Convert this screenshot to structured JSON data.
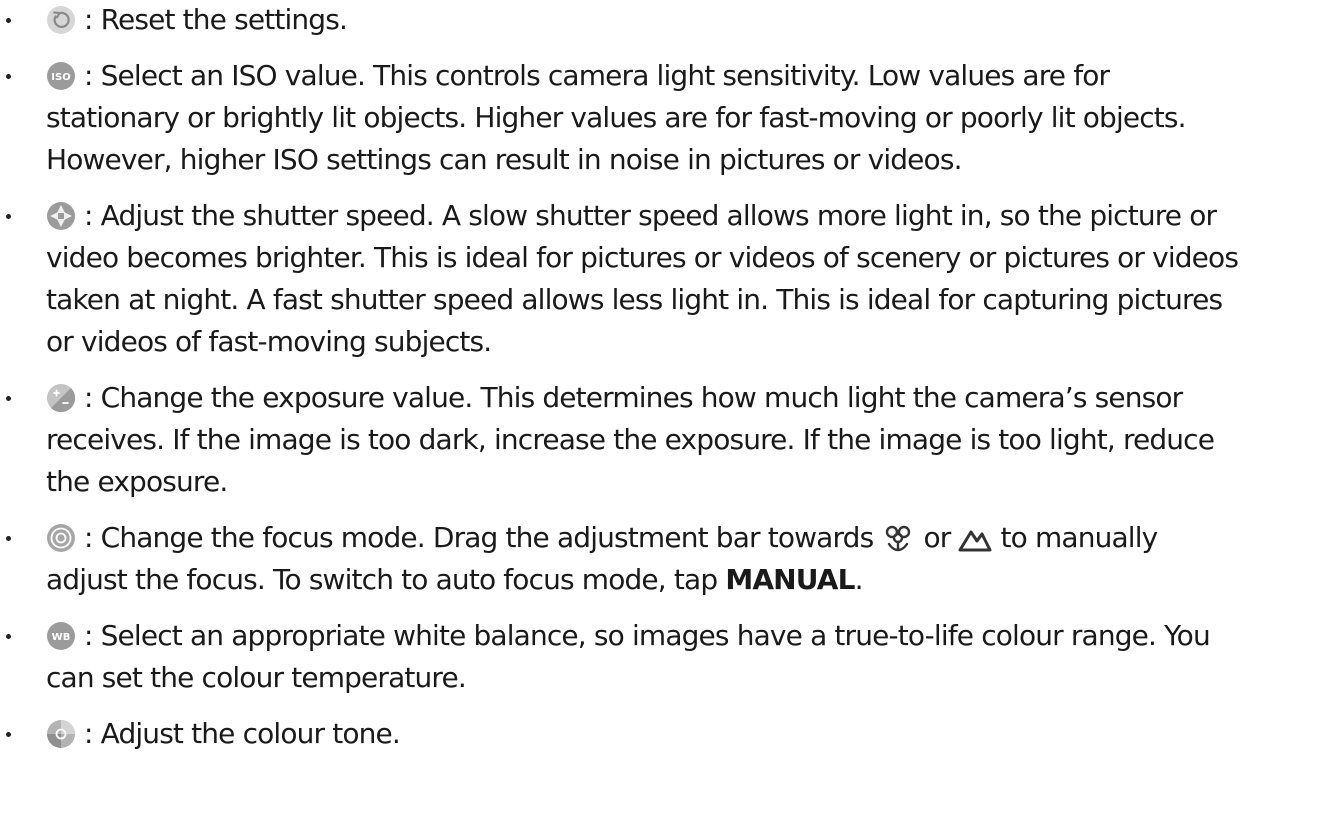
{
  "items": [
    {
      "icon": "reset-icon",
      "lines": [
        ": Reset the settings."
      ]
    },
    {
      "icon": "iso-icon",
      "icon_label": "ISO",
      "lines": [
        ": Select an ISO value. This controls camera light sensitivity. Low values are for",
        "stationary or brightly lit objects. Higher values are for fast-moving or poorly lit objects.",
        "However, higher ISO settings can result in noise in pictures or videos."
      ]
    },
    {
      "icon": "shutter-speed-icon",
      "lines": [
        ": Adjust the shutter speed. A slow shutter speed allows more light in, so the picture or",
        "video becomes brighter. This is ideal for pictures or videos of scenery or pictures or videos",
        "taken at night. A fast shutter speed allows less light in. This is ideal for capturing pictures",
        "or videos of fast-moving subjects."
      ]
    },
    {
      "icon": "exposure-icon",
      "lines": [
        ": Change the exposure value. This determines how much light the camera’s sensor",
        "receives. If the image is too dark, increase the exposure. If the image is too light, reduce",
        "the exposure."
      ]
    },
    {
      "icon": "focus-icon",
      "line1_part1": ": Change the focus mode. Drag the adjustment bar towards",
      "line1_part2": "or",
      "line1_part3": "to manually",
      "line2_part1": "adjust the focus. To switch to auto focus mode, tap",
      "line2_bold": "MANUAL",
      "line2_part2": ".",
      "inline_icons": [
        "macro-flower-icon",
        "mountain-icon"
      ]
    },
    {
      "icon": "white-balance-icon",
      "icon_label": "WB",
      "lines": [
        ": Select an appropriate white balance, so images have a true-to-life colour range. You",
        "can set the colour temperature."
      ]
    },
    {
      "icon": "colour-tone-icon",
      "lines": [
        ": Adjust the colour tone."
      ]
    }
  ],
  "colors": {
    "text": "#1a1a1a",
    "icon_gray": "#a6a6a6",
    "icon_dark": "#7a7a7a"
  }
}
